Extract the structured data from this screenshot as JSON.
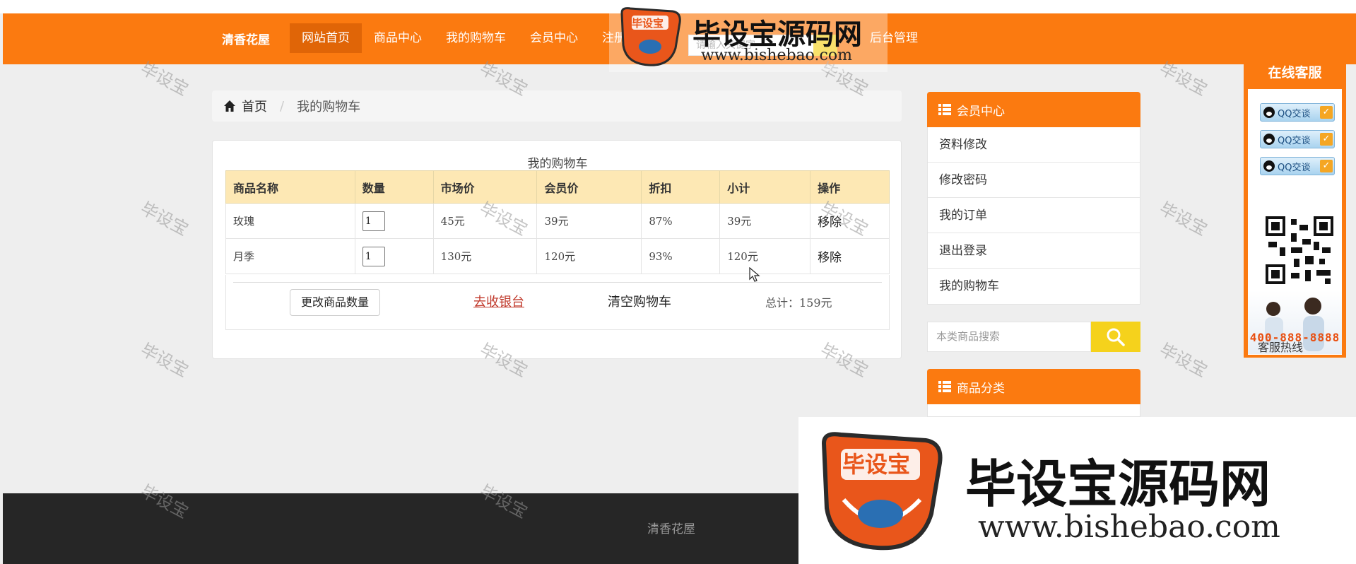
{
  "nav": {
    "brand": "清香花屋",
    "items": [
      "网站首页",
      "商品中心",
      "我的购物车",
      "会员中心",
      "注册",
      "后台管理"
    ],
    "search_placeholder": "请输入关键字"
  },
  "breadcrumb": {
    "home": "首页",
    "separator": "/",
    "current": "我的购物车"
  },
  "cart": {
    "caption": "我的购物车",
    "columns": [
      "商品名称",
      "数量",
      "市场价",
      "会员价",
      "折扣",
      "小计",
      "操作"
    ],
    "rows": [
      {
        "name": "玫瑰",
        "qty": "1",
        "market": "45元",
        "member": "39元",
        "discount": "87%",
        "subtotal": "39元",
        "op": "移除"
      },
      {
        "name": "月季",
        "qty": "1",
        "market": "130元",
        "member": "120元",
        "discount": "93%",
        "subtotal": "120元",
        "op": "移除"
      }
    ],
    "update_button": "更改商品数量",
    "checkout_link": "去收银台",
    "clear_link": "清空购物车",
    "total": "总计：159元"
  },
  "sidebar": {
    "member_title": "会员中心",
    "member_items": [
      "资料修改",
      "修改密码",
      "我的订单",
      "退出登录",
      "我的购物车"
    ],
    "search_placeholder": "本类商品搜索",
    "category_title": "商品分类"
  },
  "service": {
    "title": "在线客服",
    "qq_label": "QQ交谈",
    "hotline_label": "客服热线",
    "hotline": "400-888-8888"
  },
  "footer": {
    "text": "清香花屋"
  },
  "watermark": {
    "small": "毕设宝",
    "logo_badge": "毕设宝",
    "logo_name": "毕设宝源码网",
    "logo_url": "www.bishebao.com"
  },
  "colors": {
    "accent": "#fb7a10",
    "active": "#e06507",
    "header_row": "#fde8b4",
    "search_btn": "#f5d21c",
    "footer": "#262626"
  }
}
